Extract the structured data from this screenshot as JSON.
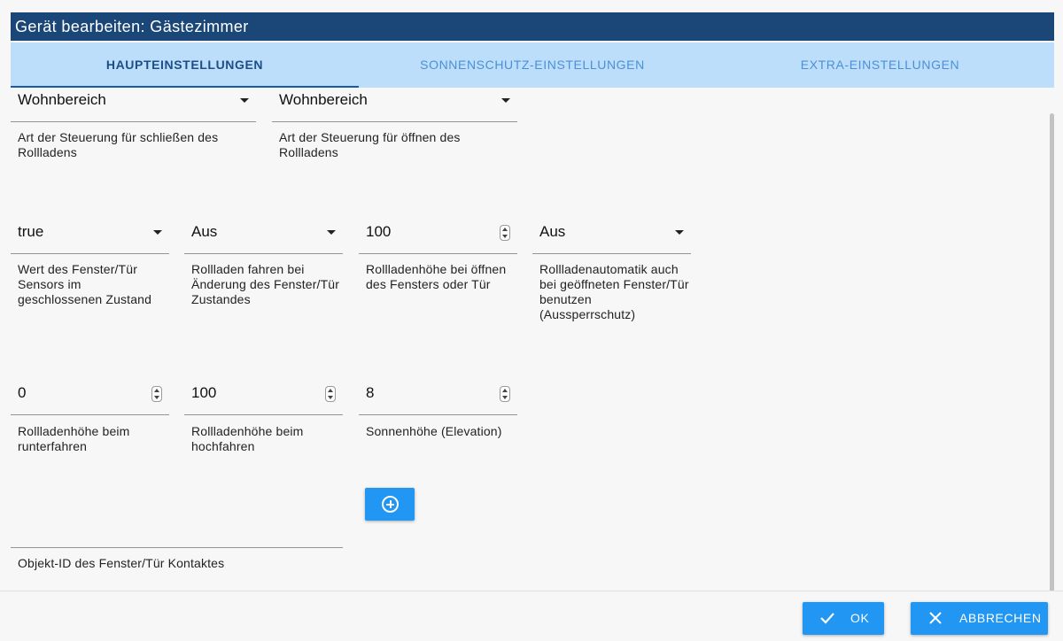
{
  "dialog": {
    "title": "Gerät bearbeiten: Gästezimmer"
  },
  "tabs": [
    {
      "label": "HAUPTEINSTELLUNGEN",
      "active": true
    },
    {
      "label": "SONNENSCHUTZ-EINSTELLUNGEN",
      "active": false
    },
    {
      "label": "EXTRA-EINSTELLUNGEN",
      "active": false
    }
  ],
  "fields": {
    "close_control": {
      "value": "Wohnbereich",
      "label": "Art der Steuerung für schließen des Rollladens"
    },
    "open_control": {
      "value": "Wohnbereich",
      "label": "Art der Steuerung für öffnen des Rollladens"
    },
    "window_sensor_value": {
      "value": "true",
      "label": "Wert des Fenster/Tür Sensors im geschlossenen Zustand"
    },
    "move_on_window_change": {
      "value": "Aus",
      "label": "Rollladen fahren bei Änderung des Fenster/Tür Zustandes"
    },
    "height_window_open": {
      "value": "100",
      "label": "Rollladenhöhe bei öffnen des Fensters oder Tür"
    },
    "lockout_protection": {
      "value": "Aus",
      "label": "Rollladenautomatik auch bei geöffneten Fenster/Tür benutzen (Aussperrschutz)"
    },
    "height_down": {
      "value": "0",
      "label": "Rollladenhöhe beim runterfahren"
    },
    "height_up": {
      "value": "100",
      "label": "Rollladenhöhe beim hochfahren"
    },
    "elevation": {
      "value": "8",
      "label": "Sonnenhöhe (Elevation)"
    },
    "window_contact_id": {
      "value": "",
      "label": "Objekt-ID des Fenster/Tür Kontaktes"
    }
  },
  "buttons": {
    "ok": "OK",
    "cancel": "ABBRECHEN"
  },
  "icons": {
    "add": "plus-circle-icon",
    "ok": "check-icon",
    "cancel": "close-icon",
    "dropdown": "caret-down-icon",
    "spinner": "spinner-arrows-icon"
  },
  "colors": {
    "header_bg": "#1a4777",
    "tabbar_bg": "#bddefa",
    "tab_active": "#1c4f87",
    "tab_inactive": "#4a90d6",
    "primary_button": "#2196f3"
  }
}
